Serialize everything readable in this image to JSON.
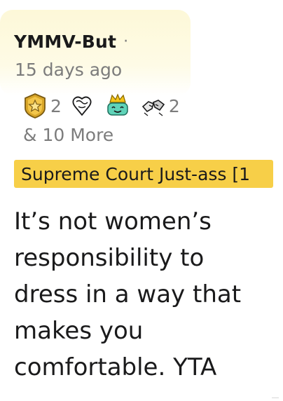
{
  "comment": {
    "username": "YMMV-But",
    "separator": "·",
    "timestamp": "15 days ago",
    "awards": [
      {
        "icon": "gold-star-shield-icon",
        "count": "2"
      },
      {
        "icon": "wholesome-hands-icon",
        "count": ""
      },
      {
        "icon": "crowned-smiley-icon",
        "count": ""
      },
      {
        "icon": "fist-bump-icon",
        "count": "2"
      }
    ],
    "more_awards": "& 10 More",
    "flair": "Supreme Court Just-ass [1",
    "body": "It’s not women’s responsibility to dress in a way that makes you comfortable. YTA"
  },
  "colors": {
    "header_highlight": "#fdf8d8",
    "flair_background": "#f7cf48",
    "meta_text": "#7c7c7c",
    "body_text": "#1a1a1b"
  }
}
